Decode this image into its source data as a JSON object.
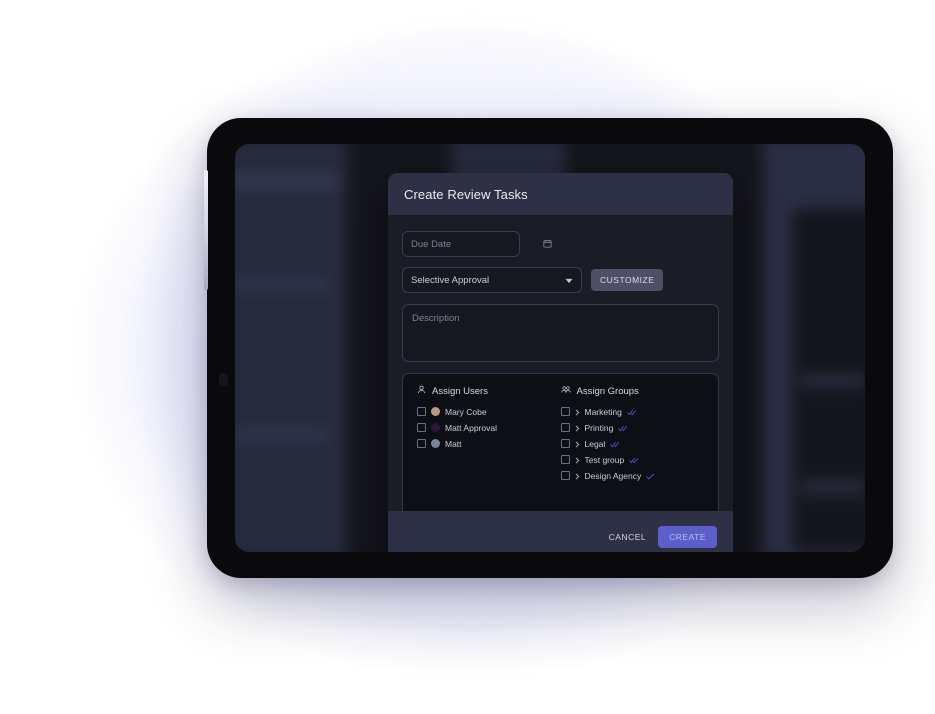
{
  "dialog": {
    "title": "Create Review Tasks",
    "due_date": {
      "placeholder": "Due Date",
      "value": "",
      "icon": "calendar-icon"
    },
    "approval_select": {
      "selected": "Selective Approval",
      "icon": "chevron-down-icon"
    },
    "customize_label": "CUSTOMIZE",
    "description": {
      "placeholder": "Description",
      "value": ""
    },
    "assign_users": {
      "heading": "Assign Users",
      "icon": "person-icon",
      "items": [
        {
          "label": "Mary Cobe",
          "checked": false,
          "avatar_color": "#b89a7c"
        },
        {
          "label": "Matt Approval",
          "checked": false,
          "avatar_color": "#2a1838"
        },
        {
          "label": "Matt",
          "checked": false,
          "avatar_color": "#7b8496"
        }
      ]
    },
    "assign_groups": {
      "heading": "Assign Groups",
      "icon": "group-icon",
      "items": [
        {
          "label": "Marketing",
          "checked": false,
          "status": "double-check"
        },
        {
          "label": "Printing",
          "checked": false,
          "status": "double-check"
        },
        {
          "label": "Legal",
          "checked": false,
          "status": "double-check"
        },
        {
          "label": "Test group",
          "checked": false,
          "status": "double-check"
        },
        {
          "label": "Design Agency",
          "checked": false,
          "status": "single-check"
        }
      ]
    },
    "footer": {
      "cancel_label": "CANCEL",
      "create_label": "CREATE"
    }
  },
  "colors": {
    "header_bg": "#2e3046",
    "body_bg": "#1b1d26",
    "field_bg": "#16171f",
    "panel_bg": "#0e0f15",
    "accent_indigo": "#5c5fc9",
    "customize_bg": "#4f4f68",
    "check_blue": "#4c5ae0",
    "glow_lavender": "#c9caf2"
  }
}
